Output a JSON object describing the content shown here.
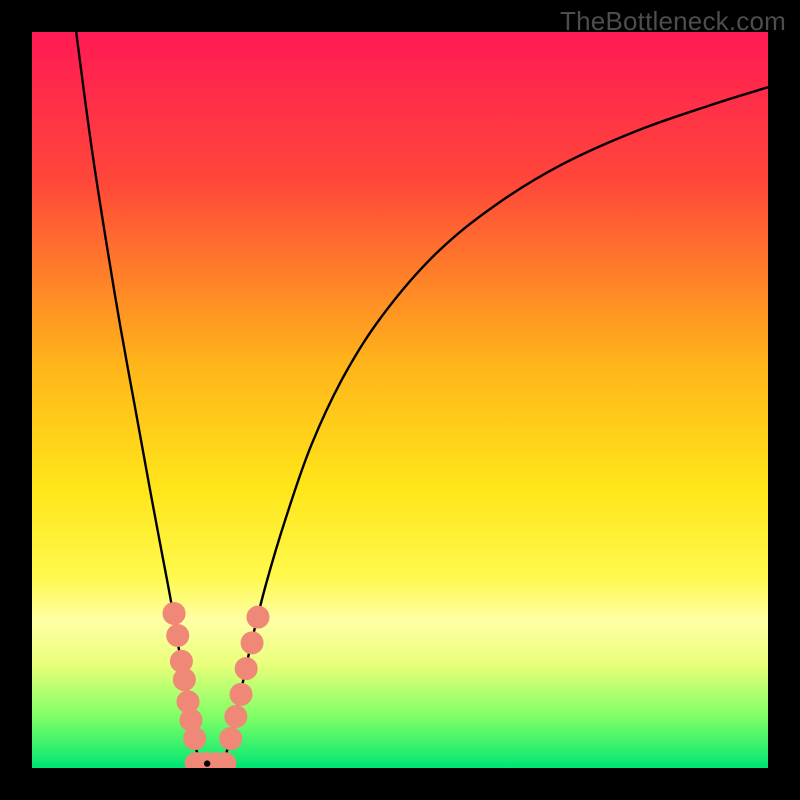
{
  "watermark": "TheBottleneck.com",
  "chart_data": {
    "type": "line",
    "title": "",
    "xlabel": "",
    "ylabel": "",
    "xlim": [
      0,
      100
    ],
    "ylim": [
      0,
      100
    ],
    "background_gradient": {
      "stops": [
        {
          "offset": 0,
          "color": "#ff1a54"
        },
        {
          "offset": 20,
          "color": "#ff463a"
        },
        {
          "offset": 45,
          "color": "#ffb41a"
        },
        {
          "offset": 62,
          "color": "#ffe61a"
        },
        {
          "offset": 74,
          "color": "#fff94d"
        },
        {
          "offset": 80,
          "color": "#ffffa6"
        },
        {
          "offset": 86,
          "color": "#e8ff7a"
        },
        {
          "offset": 93,
          "color": "#80ff66"
        },
        {
          "offset": 100,
          "color": "#00e673"
        }
      ]
    },
    "series": [
      {
        "name": "left-arm",
        "stroke": "#000000",
        "stroke_width": 2.4,
        "points": [
          {
            "x": 6.0,
            "y": 100.0
          },
          {
            "x": 8.0,
            "y": 85.0
          },
          {
            "x": 10.0,
            "y": 72.0
          },
          {
            "x": 12.0,
            "y": 60.0
          },
          {
            "x": 14.0,
            "y": 49.0
          },
          {
            "x": 16.0,
            "y": 38.0
          },
          {
            "x": 17.5,
            "y": 30.0
          },
          {
            "x": 19.0,
            "y": 22.0
          },
          {
            "x": 20.3,
            "y": 14.0
          },
          {
            "x": 21.3,
            "y": 8.0
          },
          {
            "x": 22.0,
            "y": 4.0
          },
          {
            "x": 22.6,
            "y": 1.5
          },
          {
            "x": 23.2,
            "y": 0.3
          }
        ]
      },
      {
        "name": "right-arm",
        "stroke": "#000000",
        "stroke_width": 2.4,
        "points": [
          {
            "x": 25.8,
            "y": 0.3
          },
          {
            "x": 26.4,
            "y": 2.0
          },
          {
            "x": 27.2,
            "y": 5.0
          },
          {
            "x": 28.3,
            "y": 10.0
          },
          {
            "x": 29.8,
            "y": 17.0
          },
          {
            "x": 31.8,
            "y": 25.0
          },
          {
            "x": 34.5,
            "y": 34.0
          },
          {
            "x": 38.0,
            "y": 44.0
          },
          {
            "x": 42.5,
            "y": 53.5
          },
          {
            "x": 48.0,
            "y": 62.0
          },
          {
            "x": 55.0,
            "y": 70.0
          },
          {
            "x": 63.0,
            "y": 76.5
          },
          {
            "x": 72.0,
            "y": 82.0
          },
          {
            "x": 82.0,
            "y": 86.5
          },
          {
            "x": 92.0,
            "y": 90.0
          },
          {
            "x": 100.0,
            "y": 92.5
          }
        ]
      }
    ],
    "bottom_band": {
      "name": "green-band",
      "y_from": 0,
      "y_to": 0.5,
      "color": "#00e673"
    },
    "markers": {
      "name": "cluster-dots",
      "fill": "#f08878",
      "stroke": "#f08878",
      "r": 11,
      "points": [
        {
          "x": 19.3,
          "y": 21.0
        },
        {
          "x": 19.8,
          "y": 18.0
        },
        {
          "x": 20.3,
          "y": 14.5
        },
        {
          "x": 20.7,
          "y": 12.0
        },
        {
          "x": 21.2,
          "y": 9.0
        },
        {
          "x": 21.6,
          "y": 6.5
        },
        {
          "x": 22.1,
          "y": 4.0
        },
        {
          "x": 27.0,
          "y": 4.0
        },
        {
          "x": 27.7,
          "y": 7.0
        },
        {
          "x": 28.4,
          "y": 10.0
        },
        {
          "x": 29.1,
          "y": 13.5
        },
        {
          "x": 29.9,
          "y": 17.0
        },
        {
          "x": 30.7,
          "y": 20.5
        },
        {
          "x": 22.3,
          "y": 0.6
        },
        {
          "x": 23.6,
          "y": 0.6
        },
        {
          "x": 24.9,
          "y": 0.6
        },
        {
          "x": 26.2,
          "y": 0.6
        }
      ]
    },
    "axis_nub": {
      "name": "left-arm-nub",
      "x": 23.8,
      "y": 0.6,
      "fill": "#000000",
      "r": 3.2
    }
  }
}
